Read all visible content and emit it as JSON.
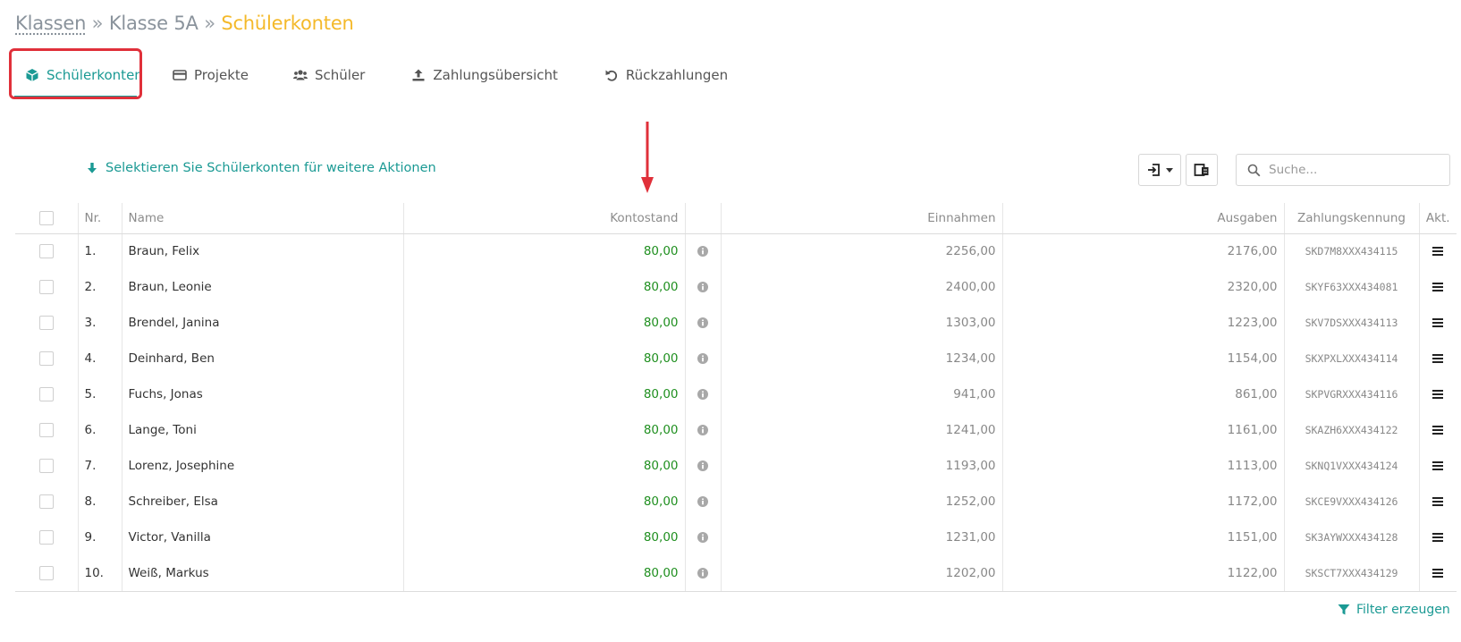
{
  "breadcrumb": {
    "root": "Klassen",
    "separator": "»",
    "middle": "Klasse 5A",
    "current": "Schülerkonten"
  },
  "tabs": [
    {
      "label": "Schülerkonten",
      "icon": "cube-icon",
      "active": true
    },
    {
      "label": "Projekte",
      "icon": "credit-card-icon",
      "active": false
    },
    {
      "label": "Schüler",
      "icon": "users-icon",
      "active": false
    },
    {
      "label": "Zahlungsübersicht",
      "icon": "upload-icon",
      "active": false
    },
    {
      "label": "Rückzahlungen",
      "icon": "undo-icon",
      "active": false
    }
  ],
  "selection_hint": "Selektieren Sie Schülerkonten für weitere Aktionen",
  "search": {
    "placeholder": "Suche..."
  },
  "table": {
    "headers": {
      "nr": "Nr.",
      "name": "Name",
      "kontostand": "Kontostand",
      "einnahmen": "Einnahmen",
      "ausgaben": "Ausgaben",
      "zahlungskennung": "Zahlungskennung",
      "aktionen": "Akt."
    },
    "rows": [
      {
        "nr": "1.",
        "name": "Braun, Felix",
        "kontostand": "80,00",
        "einnahmen": "2256,00",
        "ausgaben": "2176,00",
        "zahlungskennung": "SKD7M8XXX434115"
      },
      {
        "nr": "2.",
        "name": "Braun, Leonie",
        "kontostand": "80,00",
        "einnahmen": "2400,00",
        "ausgaben": "2320,00",
        "zahlungskennung": "SKYF63XXX434081"
      },
      {
        "nr": "3.",
        "name": "Brendel, Janina",
        "kontostand": "80,00",
        "einnahmen": "1303,00",
        "ausgaben": "1223,00",
        "zahlungskennung": "SKV7DSXXX434113"
      },
      {
        "nr": "4.",
        "name": "Deinhard, Ben",
        "kontostand": "80,00",
        "einnahmen": "1234,00",
        "ausgaben": "1154,00",
        "zahlungskennung": "SKXPXLXXX434114"
      },
      {
        "nr": "5.",
        "name": "Fuchs, Jonas",
        "kontostand": "80,00",
        "einnahmen": "941,00",
        "ausgaben": "861,00",
        "zahlungskennung": "SKPVGRXXX434116"
      },
      {
        "nr": "6.",
        "name": "Lange, Toni",
        "kontostand": "80,00",
        "einnahmen": "1241,00",
        "ausgaben": "1161,00",
        "zahlungskennung": "SKAZH6XXX434122"
      },
      {
        "nr": "7.",
        "name": "Lorenz, Josephine",
        "kontostand": "80,00",
        "einnahmen": "1193,00",
        "ausgaben": "1113,00",
        "zahlungskennung": "SKNQ1VXXX434124"
      },
      {
        "nr": "8.",
        "name": "Schreiber, Elsa",
        "kontostand": "80,00",
        "einnahmen": "1252,00",
        "ausgaben": "1172,00",
        "zahlungskennung": "SKCE9VXXX434126"
      },
      {
        "nr": "9.",
        "name": "Victor, Vanilla",
        "kontostand": "80,00",
        "einnahmen": "1231,00",
        "ausgaben": "1151,00",
        "zahlungskennung": "SK3AYWXXX434128"
      },
      {
        "nr": "10.",
        "name": "Weiß, Markus",
        "kontostand": "80,00",
        "einnahmen": "1202,00",
        "ausgaben": "1122,00",
        "zahlungskennung": "SKSCT7XXX434129"
      }
    ]
  },
  "filter_link": "Filter erzeugen",
  "colors": {
    "accent": "#1b9a94",
    "breadcrumb_current": "#f4b92a",
    "balance_positive": "#1f8f1f",
    "annotation": "#e0303a"
  }
}
